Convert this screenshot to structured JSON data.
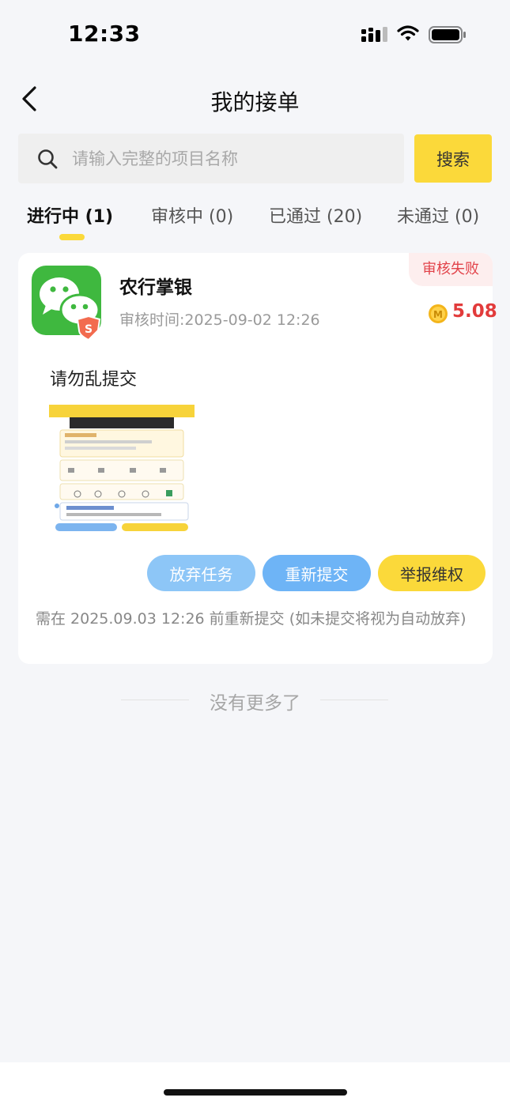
{
  "status_bar": {
    "time": "12:33",
    "icons": [
      "signal-icon",
      "wifi-icon",
      "battery-icon"
    ]
  },
  "nav": {
    "title": "我的接单",
    "back_icon": "chevron-left-icon"
  },
  "search": {
    "placeholder": "请输入完整的项目名称",
    "value": "",
    "button_label": "搜索",
    "icon": "search-icon"
  },
  "tabs": [
    {
      "label": "进行中 (1)",
      "active": true
    },
    {
      "label": "审核中 (0)",
      "active": false
    },
    {
      "label": "已通过 (20)",
      "active": false
    },
    {
      "label": "未通过 (0)",
      "active": false
    }
  ],
  "task": {
    "app_name": "农行掌银",
    "review_time": "审核时间:2025-09-02 12:26",
    "status": "审核失败",
    "reward": "5.08",
    "remark": "请勿乱提交",
    "actions": {
      "abandon": "放弃任务",
      "resubmit": "重新提交",
      "report": "举报维权"
    },
    "deadline_note": "需在 2025.09.03 12:26 前重新提交 (如未提交将视为自动放弃)"
  },
  "list_end": "没有更多了",
  "colors": {
    "accent_yellow": "#fbd93a",
    "blue_button": "#6eb4f6",
    "fail_red": "#e2434a",
    "reward_red": "#e23b3b",
    "wechat_green": "#3fb83f"
  }
}
